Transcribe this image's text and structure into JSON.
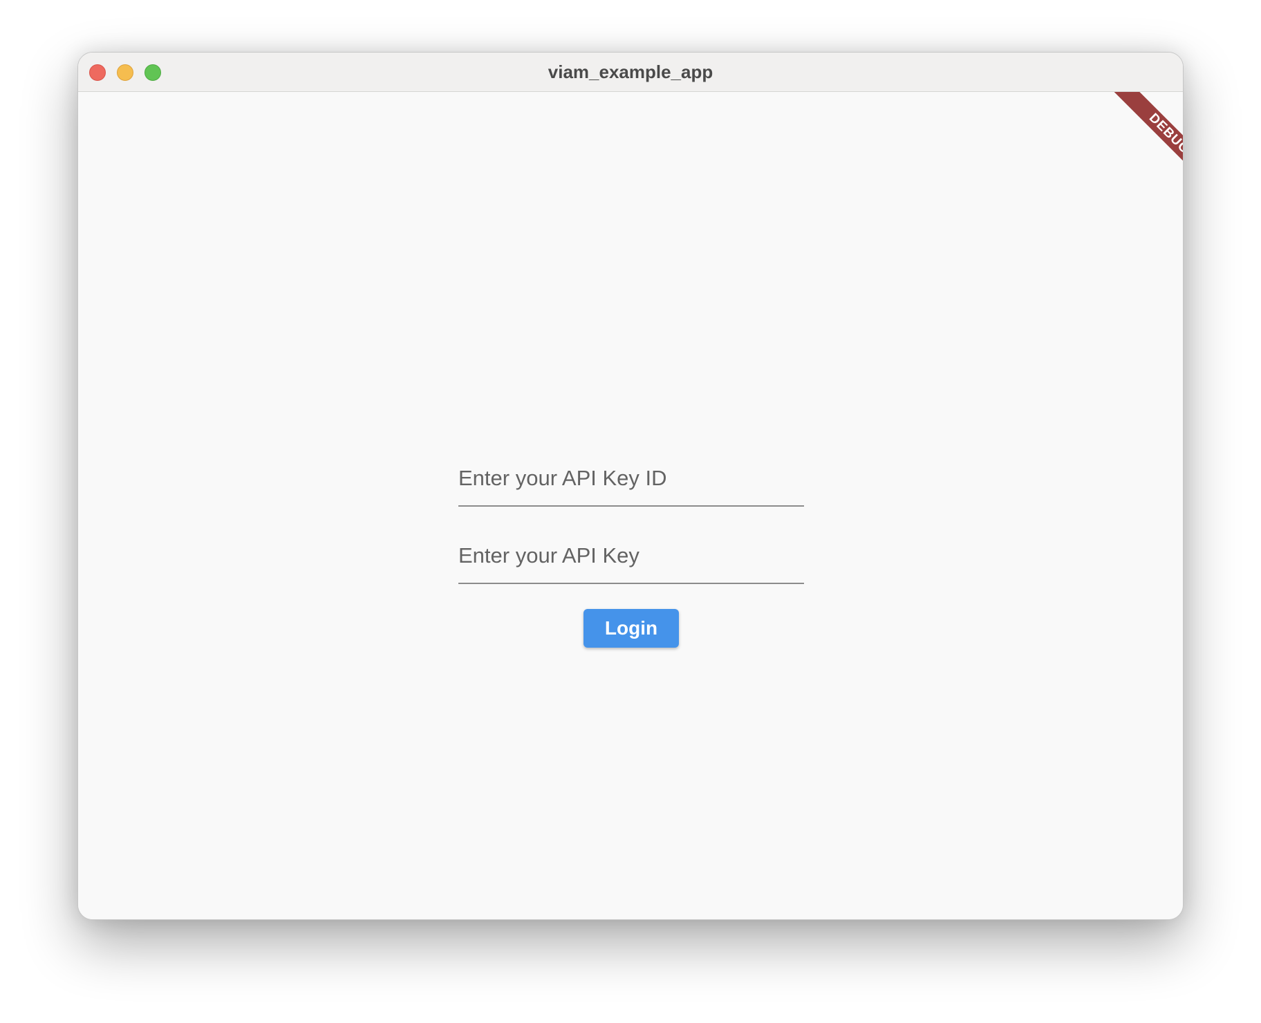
{
  "window": {
    "title": "viam_example_app"
  },
  "form": {
    "api_key_id": {
      "value": "",
      "placeholder": "Enter your API Key ID"
    },
    "api_key": {
      "value": "",
      "placeholder": "Enter your API Key"
    },
    "login_label": "Login"
  },
  "debug_banner": {
    "label": "DEBUG",
    "color": "#9a3f3e"
  },
  "colors": {
    "accent": "#4593ea",
    "close": "#ee6a5f",
    "minimize": "#f5bd4f",
    "zoom": "#61c454"
  }
}
